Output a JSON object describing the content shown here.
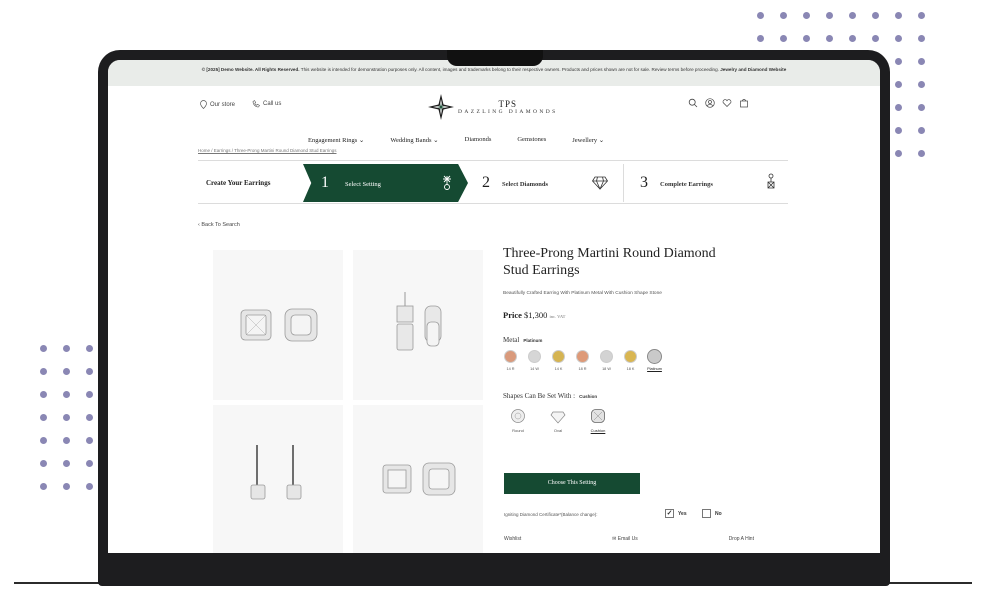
{
  "announcement": {
    "lead": "© [2025] Demo Website. All Rights Reserved.",
    "body": "This website is intended for demonstration purposes only. All content, images and trademarks belong to their respective owners. Products and prices shown are not for sale. Review terms before proceeding.",
    "brand": "Jewelry and Diamond Website"
  },
  "header": {
    "our_store": "Our store",
    "call_us": "Call us",
    "logo_line1": "TPS",
    "logo_line2": "DAZZLING DIAMONDS"
  },
  "nav": [
    "Engagement Rings ⌄",
    "Wedding Bands ⌄",
    "Diamonds",
    "Gemstones",
    "Jewellery ⌄"
  ],
  "breadcrumb": "Home / Earrings / Three-Prong Martini Round Diamond Stud Earrings",
  "steps": {
    "title": "Create Your Earrings",
    "s1_num": "1",
    "s1_label": "Select Setting",
    "s2_num": "2",
    "s2_label": "Select Diamonds",
    "s3_num": "3",
    "s3_label": "Complete Earrings"
  },
  "back_link": "‹ Back To Search",
  "product": {
    "title": "Three-Prong Martini Round Diamond Stud Earrings",
    "description": "Beautifully Crafted Earring With Platinum Metal With Cushion Shape Stone",
    "price_label": "Price",
    "price_value": "$1,300",
    "price_tax": "inc. VAT",
    "metal_label": "Metal",
    "metal_selected": "Platinum",
    "shapes_label": "Shapes Can Be Set With :",
    "shape_selected": "Cushion",
    "choose_button": "Choose This Setting",
    "cert_label": "Igniting Diamond Certificate*(Balance change):",
    "yes_label": "Yes",
    "no_label": "No",
    "wishlist": "Wishlist",
    "email_us": "Email Us",
    "drop_hint": "Drop A Hint"
  },
  "metals": [
    {
      "cap": "14 R",
      "color": "#d99a7c"
    },
    {
      "cap": "14 W",
      "color": "#d6d6d6"
    },
    {
      "cap": "14 K",
      "color": "#d5b452"
    },
    {
      "cap": "18 R",
      "color": "#de9a78"
    },
    {
      "cap": "18 W",
      "color": "#d3d3d3"
    },
    {
      "cap": "18 K",
      "color": "#d9b652"
    },
    {
      "cap": "Platinum",
      "color": "#c9c9c9"
    }
  ],
  "shapes": [
    "Round",
    "Oval",
    "Cushion"
  ],
  "colors": {
    "accent": "#154a32",
    "dots": "#8a87b4",
    "laptop": "#1d1d1f"
  }
}
